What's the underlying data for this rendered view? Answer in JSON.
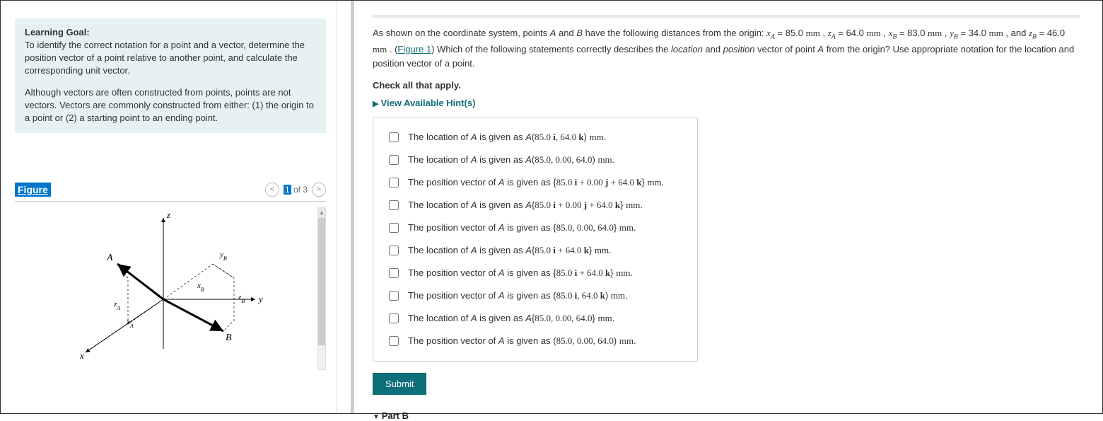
{
  "learning_goal": {
    "title": "Learning Goal:",
    "para1": "To identify the correct notation for a point and a vector, determine the position vector of a point relative to another point, and calculate the corresponding unit vector.",
    "para2": "Although vectors are often constructed from points, points are not vectors. Vectors are commonly constructed from either: (1) the origin to a point or (2) a starting point to an ending point."
  },
  "figure": {
    "label": "Figure",
    "page_current": "1",
    "page_sep": "of 3",
    "prev": "<",
    "next": ">"
  },
  "problem": {
    "intro_1": "As shown on the coordinate system, points ",
    "ab": "A",
    "intro_2": " and ",
    "b": "B",
    "intro_3": " have the following distances from the origin: ",
    "xA_lbl": "x",
    "xA_sub": "A",
    "xA_val": " = 85.0 ",
    "zA_lbl": "z",
    "zA_sub": "A",
    "zA_val": " = 64.0 ",
    "xB_lbl": "x",
    "xB_sub": "B",
    "xB_val": " = 83.0 ",
    "yB_lbl": "y",
    "yB_sub": "B",
    "yB_val": " = 34.0 ",
    "zB_lbl": "z",
    "zB_sub": "B",
    "zB_val": " = 46.0 ",
    "mm": "mm",
    "figlink": "Figure 1",
    "rest": ") Which of the following statements correctly describes the ",
    "loc_word": "location",
    "and_word": " and ",
    "pos_word": "position",
    "rest2": " vector of point ",
    "rest3": " from the origin? Use appropriate notation for the location and position vector of a point.",
    "check_all": "Check all that apply.",
    "hints": "View Available Hint(s)"
  },
  "options": [
    {
      "pre": "The location of ",
      "mid": " is given as ",
      "sym": "A",
      "left": "(",
      "body": "85.0 <b>i</b>, 64.0 <b>k</b>",
      "right": ")"
    },
    {
      "pre": "The location of ",
      "mid": " is given as ",
      "sym": "A",
      "left": "(",
      "body": "85.0, 0.00, 64.0",
      "right": ")"
    },
    {
      "pre": "The position vector of ",
      "mid": " is given as ",
      "sym": "",
      "left": "{",
      "body": "85.0 <b>i</b> + 0.00 <b>j</b> + 64.0 <b>k</b>",
      "right": "}"
    },
    {
      "pre": "The location of ",
      "mid": " is given as ",
      "sym": "A",
      "left": "{",
      "body": "85.0 <b>i</b> + 0.00 <b>j</b> + 64.0 <b>k</b>",
      "right": "}"
    },
    {
      "pre": "The position vector of ",
      "mid": " is given as ",
      "sym": "",
      "left": "{",
      "body": "85.0, 0.00, 64.0",
      "right": "}"
    },
    {
      "pre": "The location of ",
      "mid": " is given as ",
      "sym": "A",
      "left": "{",
      "body": "85.0 <b>i</b> + 64.0 <b>k</b>",
      "right": "}"
    },
    {
      "pre": "The position vector of ",
      "mid": " is given as ",
      "sym": "",
      "left": "{",
      "body": "85.0 <b>i</b> + 64.0 <b>k</b>",
      "right": "}"
    },
    {
      "pre": "The position vector of ",
      "mid": " is given as ",
      "sym": "",
      "left": "(",
      "body": "85.0 <b>i</b>, 64.0 <b>k</b>",
      "right": ")"
    },
    {
      "pre": "The location of ",
      "mid": " is given as ",
      "sym": "A",
      "left": "{",
      "body": "85.0, 0.00, 64.0",
      "right": "}"
    },
    {
      "pre": "The position vector of ",
      "mid": " is given as ",
      "sym": "",
      "left": "(",
      "body": "85.0, 0.00, 64.0",
      "right": ")"
    }
  ],
  "submit": "Submit",
  "part_b": "Part B"
}
